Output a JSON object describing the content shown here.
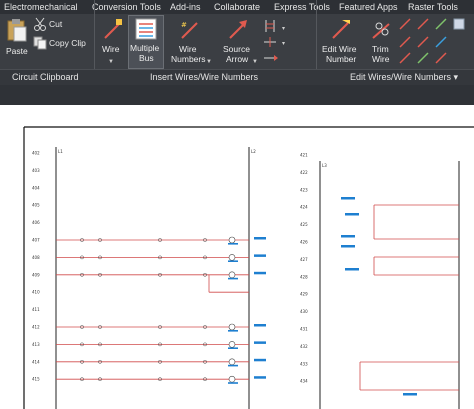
{
  "ribbon": {
    "tabs": [
      "Electromechanical",
      "Conversion Tools",
      "Add-ins",
      "Collaborate",
      "Express Tools",
      "Featured Apps",
      "Raster Tools"
    ],
    "clipboard": {
      "paste": "Paste",
      "cut": "Cut",
      "copy": "Copy Clip",
      "panel": "Circuit Clipboard"
    },
    "insert": {
      "wire": "Wire",
      "multi1": "Multiple",
      "multi2": "Bus",
      "numbers1": "Wire",
      "numbers2": "Numbers",
      "arrow1": "Source",
      "arrow2": "Arrow",
      "panel": "Insert Wires/Wire Numbers"
    },
    "edit": {
      "edit1": "Edit Wire",
      "edit2": "Number",
      "trim1": "Trim",
      "trim2": "Wire",
      "panel": "Edit Wires/Wire Numbers",
      "panel_caret": "▾"
    }
  },
  "drawing": {
    "left_rungs": [
      "402",
      "403",
      "404",
      "405",
      "406",
      "407",
      "408",
      "409",
      "410",
      "411",
      "412",
      "413",
      "414",
      "415"
    ],
    "right_rungs": [
      "421",
      "422",
      "423",
      "424",
      "425",
      "426",
      "427",
      "428",
      "429",
      "430",
      "431",
      "432",
      "433",
      "434"
    ],
    "rail_labels": [
      "L1",
      "L2",
      "L3"
    ],
    "colors": {
      "wire": "#d14b4b",
      "rail": "#222222",
      "device": "#1e7fd0",
      "ribbon": "#3b3e43"
    }
  }
}
